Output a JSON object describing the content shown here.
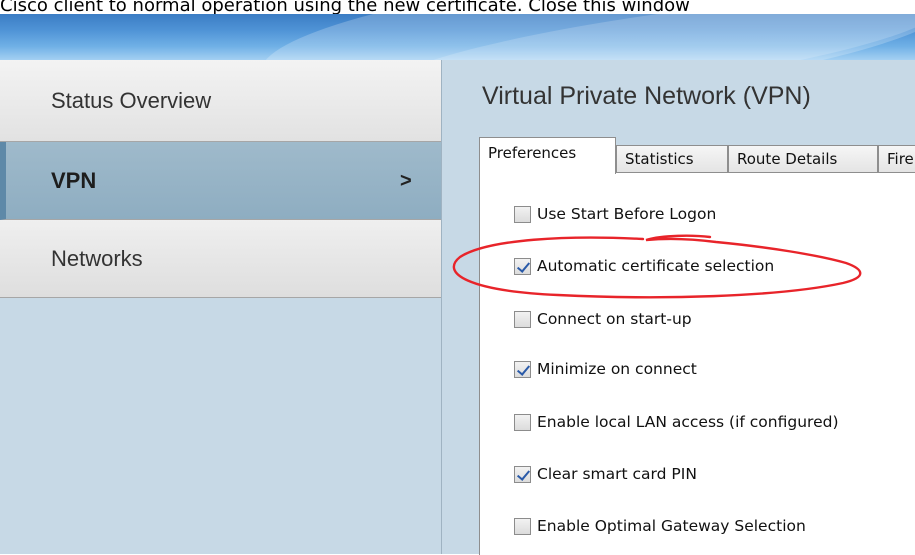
{
  "instruction_text": "Cisco client to normal operation using the new certificate. Close this window",
  "sidebar": {
    "items": [
      {
        "label": "Status Overview"
      },
      {
        "label": "VPN",
        "chevron": ">"
      },
      {
        "label": "Networks"
      }
    ]
  },
  "main": {
    "title": "Virtual Private Network (VPN)",
    "tabs": [
      {
        "label": "Preferences",
        "active": true
      },
      {
        "label": "Statistics"
      },
      {
        "label": "Route Details"
      },
      {
        "label": "Fire"
      }
    ]
  },
  "options": [
    {
      "label": "Use Start Before Logon",
      "checked": false
    },
    {
      "label": "Automatic certificate selection",
      "checked": true
    },
    {
      "label": "Connect on start-up",
      "checked": false
    },
    {
      "label": "Minimize on connect",
      "checked": true
    },
    {
      "label": "Enable local LAN access (if configured)",
      "checked": false
    },
    {
      "label": "Clear smart card PIN",
      "checked": true
    },
    {
      "label": "Enable Optimal Gateway Selection",
      "checked": false
    }
  ],
  "colors": {
    "sidebar_bg": "#c7d9e6",
    "annotation": "#e8242a",
    "check": "#2a5aa8"
  }
}
